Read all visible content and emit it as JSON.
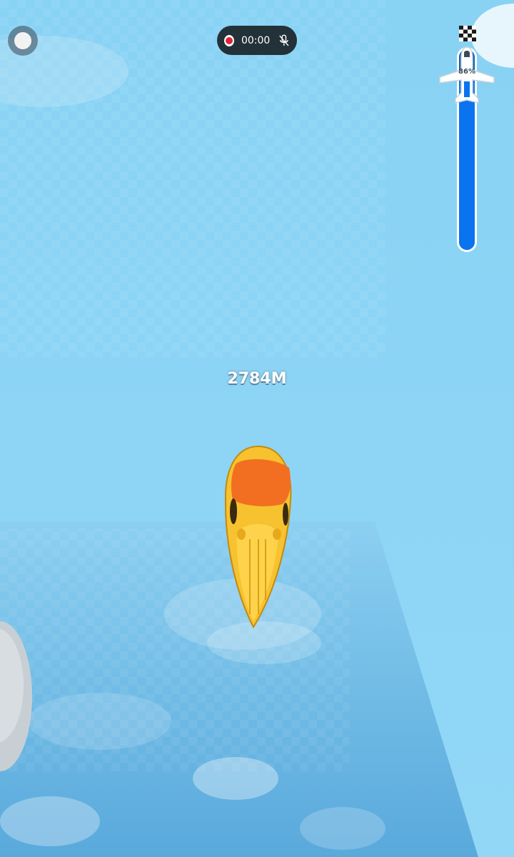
{
  "hud": {
    "recording_time": "00:00",
    "distance": "2784M",
    "progress_percent_label": "86%",
    "progress_fraction": 0.86
  },
  "colors": {
    "sky": "#8ed6f6",
    "water": "#69b7e3",
    "progress_fill": "#0a73f0",
    "rocket_body": "#f6c22f",
    "rocket_nose": "#f26f21",
    "record_red": "#e0233a"
  },
  "icons": {
    "menu": "circle-menu-icon",
    "record": "record-dot-icon",
    "mic": "mic-off-icon",
    "finish": "checkered-flag-icon",
    "plane": "airplane-icon"
  }
}
